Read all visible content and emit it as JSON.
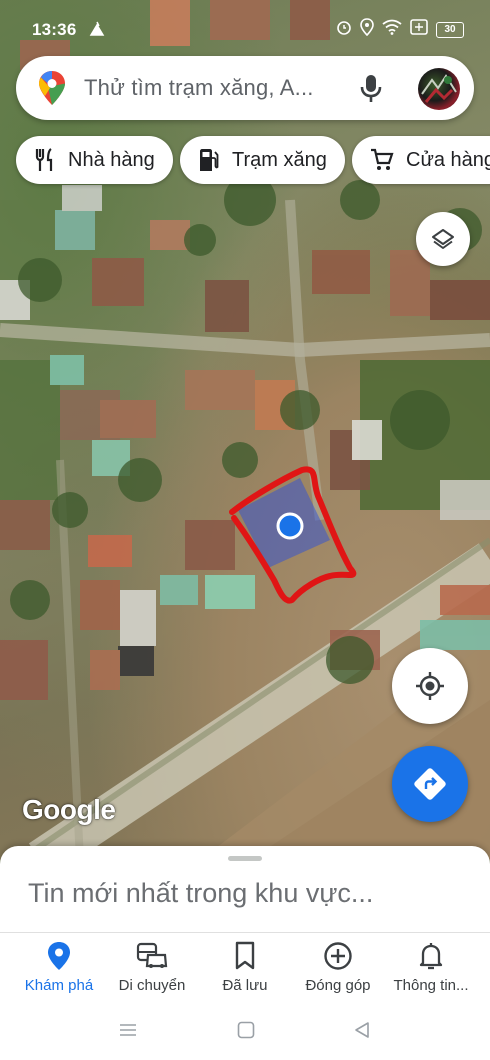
{
  "status_bar": {
    "time": "13:36",
    "battery": "30"
  },
  "search": {
    "placeholder": "Thử tìm trạm xăng, A..."
  },
  "chips": [
    {
      "label": "Nhà hàng",
      "icon": "restaurant-icon"
    },
    {
      "label": "Trạm xăng",
      "icon": "gas-station-icon"
    },
    {
      "label": "Cửa hàng",
      "icon": "shopping-cart-icon"
    }
  ],
  "map": {
    "attribution": "Google",
    "annotation_color": "#e01515",
    "location_dot_color": "#1a73e8"
  },
  "sheet": {
    "title": "Tin mới nhất trong khu vực..."
  },
  "bottom_nav": [
    {
      "label": "Khám phá",
      "icon": "explore-pin-icon",
      "active": true
    },
    {
      "label": "Di chuyển",
      "icon": "commute-icon",
      "active": false
    },
    {
      "label": "Đã lưu",
      "icon": "bookmark-icon",
      "active": false
    },
    {
      "label": "Đóng góp",
      "icon": "add-circle-icon",
      "active": false
    },
    {
      "label": "Thông tin...",
      "icon": "bell-icon",
      "active": false
    }
  ],
  "colors": {
    "accent": "#1a73e8",
    "surface": "#ffffff"
  }
}
